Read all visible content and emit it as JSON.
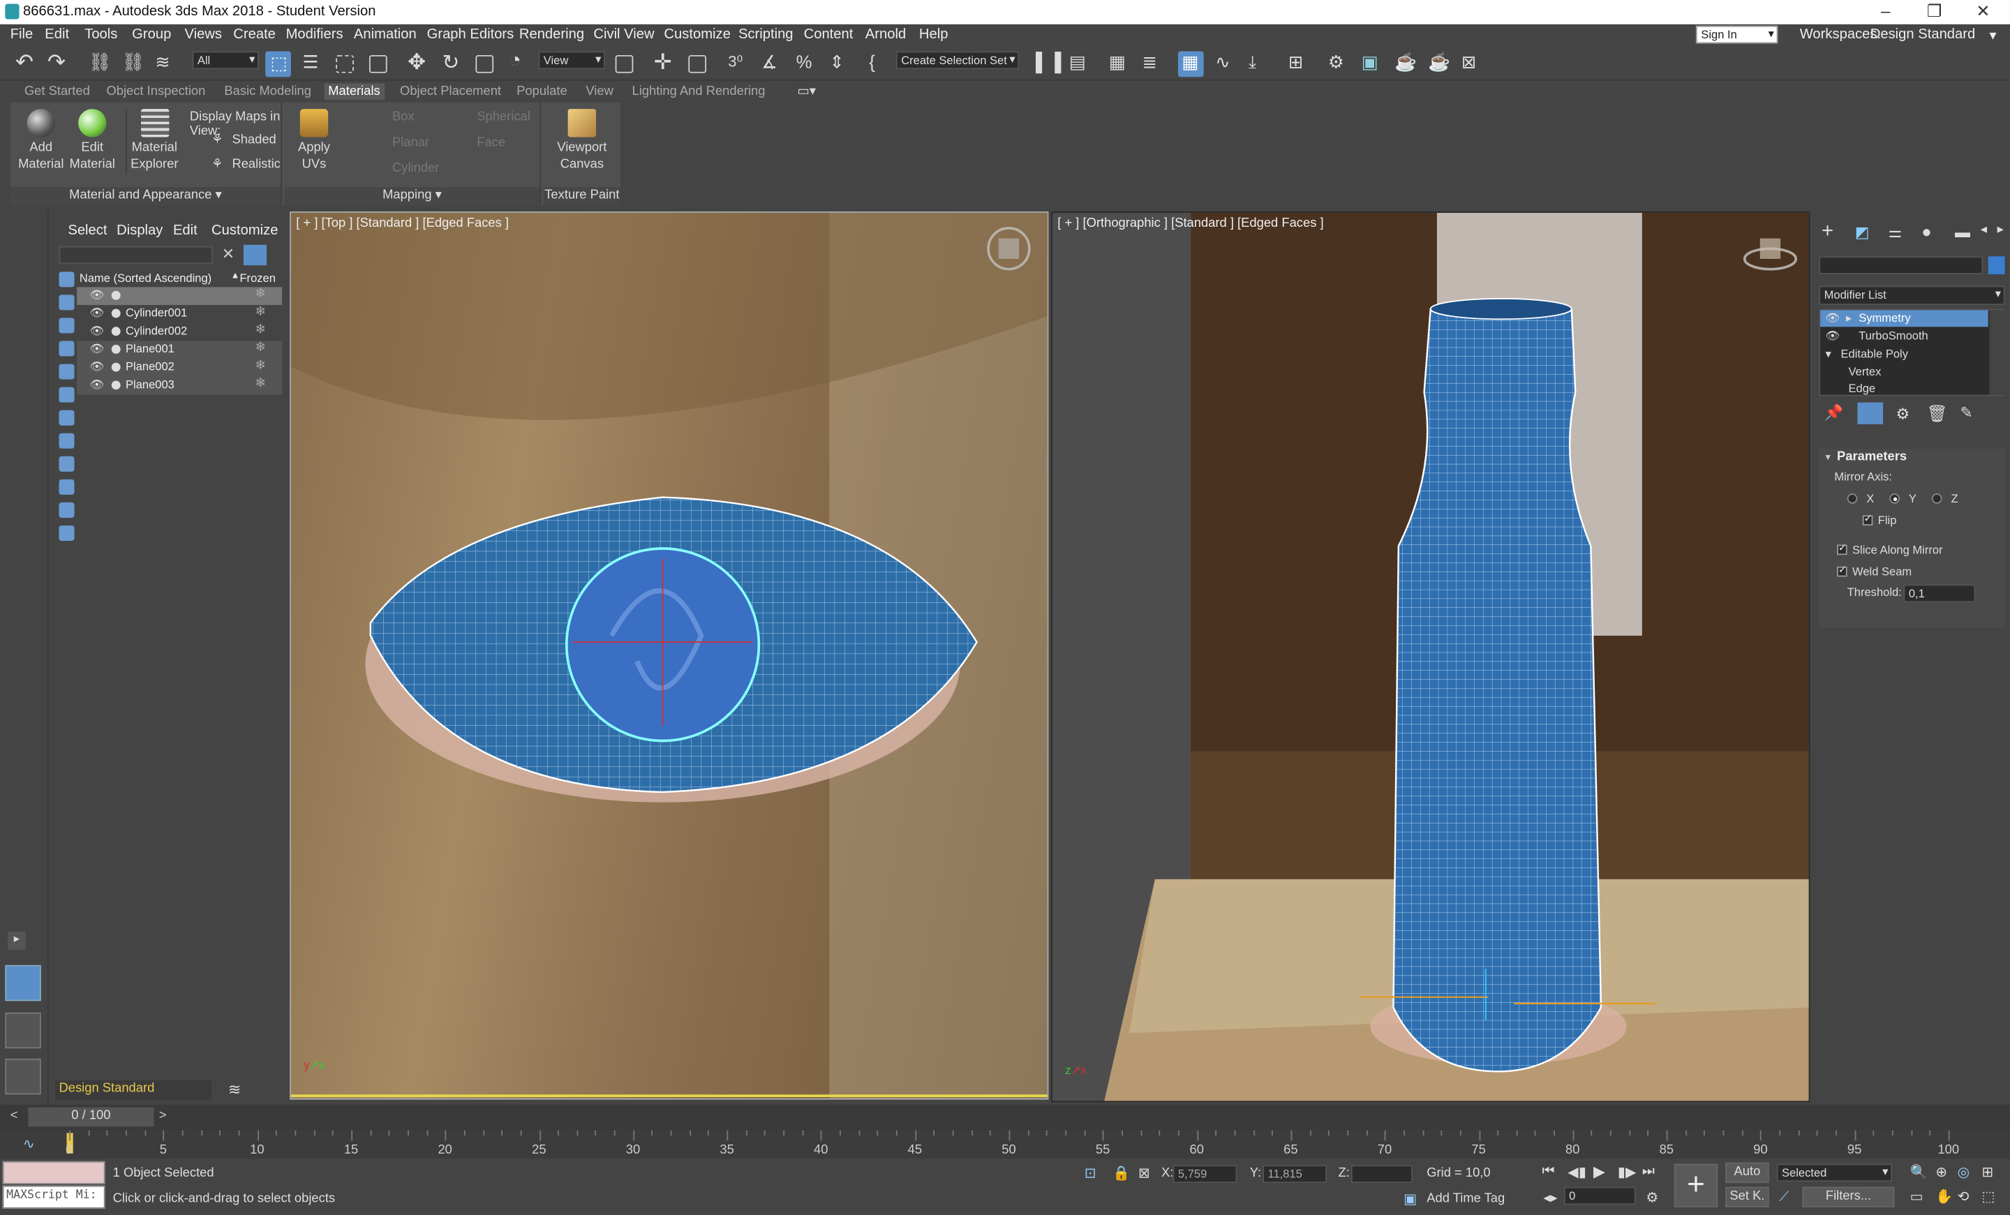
{
  "window": {
    "title": "866631.max - Autodesk 3ds Max 2018 - Student Version"
  },
  "menu": [
    "File",
    "Edit",
    "Tools",
    "Group",
    "Views",
    "Create",
    "Modifiers",
    "Animation",
    "Graph Editors",
    "Rendering",
    "Civil View",
    "Customize",
    "Scripting",
    "Content",
    "Arnold",
    "Help"
  ],
  "account": {
    "sign_in": "Sign In",
    "workspaces_label": "Workspaces:",
    "workspace": "Design Standard"
  },
  "toolbar": {
    "filter": "All",
    "view": "View",
    "selection_set": "Create Selection Set"
  },
  "ribbon_tabs": [
    "Get Started",
    "Object Inspection",
    "Basic Modeling",
    "Materials",
    "Object Placement",
    "Populate",
    "View",
    "Lighting And Rendering"
  ],
  "ribbon": {
    "add_material": [
      "Add",
      "Material"
    ],
    "edit_material": [
      "Edit",
      "Material"
    ],
    "material_explorer": [
      "Material",
      "Explorer"
    ],
    "display_maps": "Display Maps in View:",
    "shaded": "Shaded",
    "realistic": "Realistic",
    "group_material": "Material and Appearance",
    "apply_uvs": [
      "Apply",
      "UVs"
    ],
    "box": "Box",
    "planar": "Planar",
    "cylinder": "Cylinder",
    "spherical": "Spherical",
    "face": "Face",
    "group_mapping": "Mapping",
    "viewport_canvas": [
      "Viewport",
      "Canvas"
    ],
    "group_texture": "Texture Paint"
  },
  "scene_explorer": {
    "tabs": [
      "Select",
      "Display",
      "Edit",
      "Customize"
    ],
    "col_name": "Name (Sorted Ascending)",
    "col_frozen": "Frozen",
    "rows": [
      "",
      "Cylinder001",
      "Cylinder002",
      "Plane001",
      "Plane002",
      "Plane003"
    ],
    "workspace": "Design Standard"
  },
  "viewports": {
    "left_label": "[ + ] [Top ] [Standard ] [Edged Faces ]",
    "right_label": "[ + ] [Orthographic ] [Standard ] [Edged Faces ]"
  },
  "command_panel": {
    "modifier_list": "Modifier List",
    "stack": [
      "Symmetry",
      "TurboSmooth",
      "Editable Poly",
      "Vertex",
      "Edge"
    ],
    "rollout": "Parameters",
    "mirror_axis": "Mirror Axis:",
    "axes": [
      "X",
      "Y",
      "Z"
    ],
    "selected_axis": "Y",
    "flip": "Flip",
    "slice": "Slice Along Mirror",
    "weld": "Weld Seam",
    "threshold_label": "Threshold:",
    "threshold": "0,1"
  },
  "timeline": {
    "frame": "0 / 100",
    "ticks": [
      "0",
      "5",
      "10",
      "15",
      "20",
      "25",
      "30",
      "35",
      "40",
      "45",
      "50",
      "55",
      "60",
      "65",
      "70",
      "75",
      "80",
      "85",
      "90",
      "95",
      "100"
    ]
  },
  "status": {
    "maxscript": "MAXScript Mi:",
    "selected": "1 Object Selected",
    "prompt": "Click or click-and-drag to select objects",
    "x_label": "X:",
    "x": "5,759",
    "y_label": "Y:",
    "y": "11,815",
    "z_label": "Z:",
    "z": "",
    "grid": "Grid = 10,0",
    "add_time_tag": "Add Time Tag",
    "auto": "Auto",
    "set_key": "Set K.",
    "key_mode": "Selected",
    "filters": "Filters...",
    "frame_field": "0"
  }
}
